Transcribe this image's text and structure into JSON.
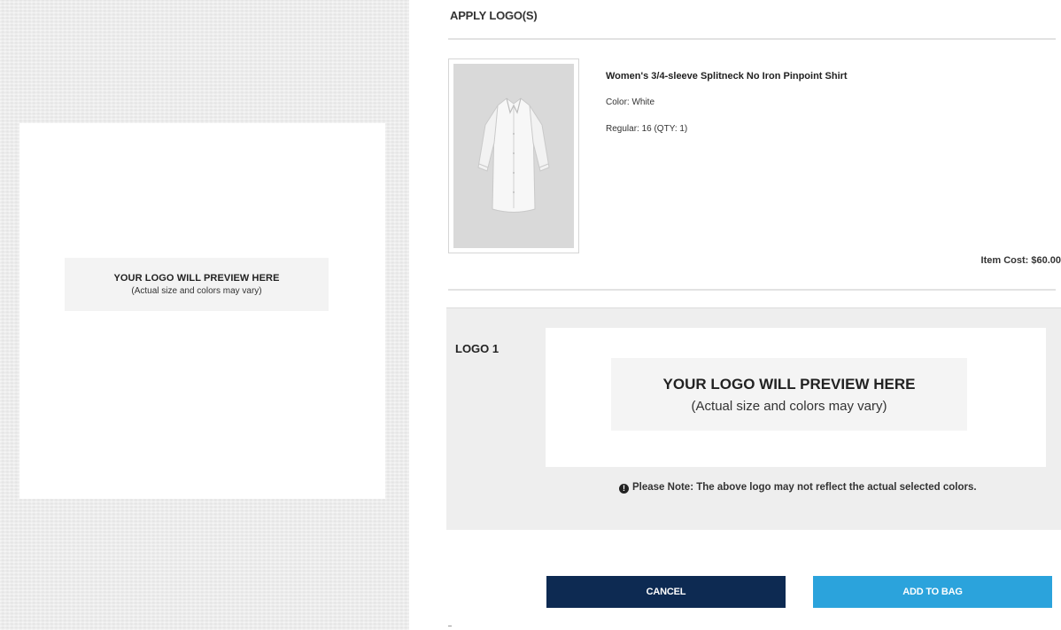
{
  "preview": {
    "title": "YOUR LOGO WILL PREVIEW HERE",
    "subtitle": "(Actual size and colors may vary)"
  },
  "header": {
    "title": "APPLY LOGO(S)"
  },
  "product": {
    "name": "Women's 3/4-sleeve Splitneck No Iron Pinpoint Shirt",
    "color": "Color: White",
    "size": "Regular: 16 (QTY: 1)",
    "item_cost": "Item Cost: $60.00",
    "image_icon": "shirt-icon"
  },
  "logo": {
    "label": "LOGO 1",
    "preview_title": "YOUR LOGO WILL PREVIEW HERE",
    "preview_subtitle": "(Actual size and colors may vary)",
    "note": "Please Note: The above logo may not reflect the actual selected colors.",
    "note_icon": "info-icon"
  },
  "actions": {
    "cancel_label": "CANCEL",
    "add_label": "ADD TO BAG"
  },
  "colors": {
    "cancel_bg": "#0d2a52",
    "add_bg": "#2ba3dc",
    "logo_section_bg": "#eeeeee"
  }
}
